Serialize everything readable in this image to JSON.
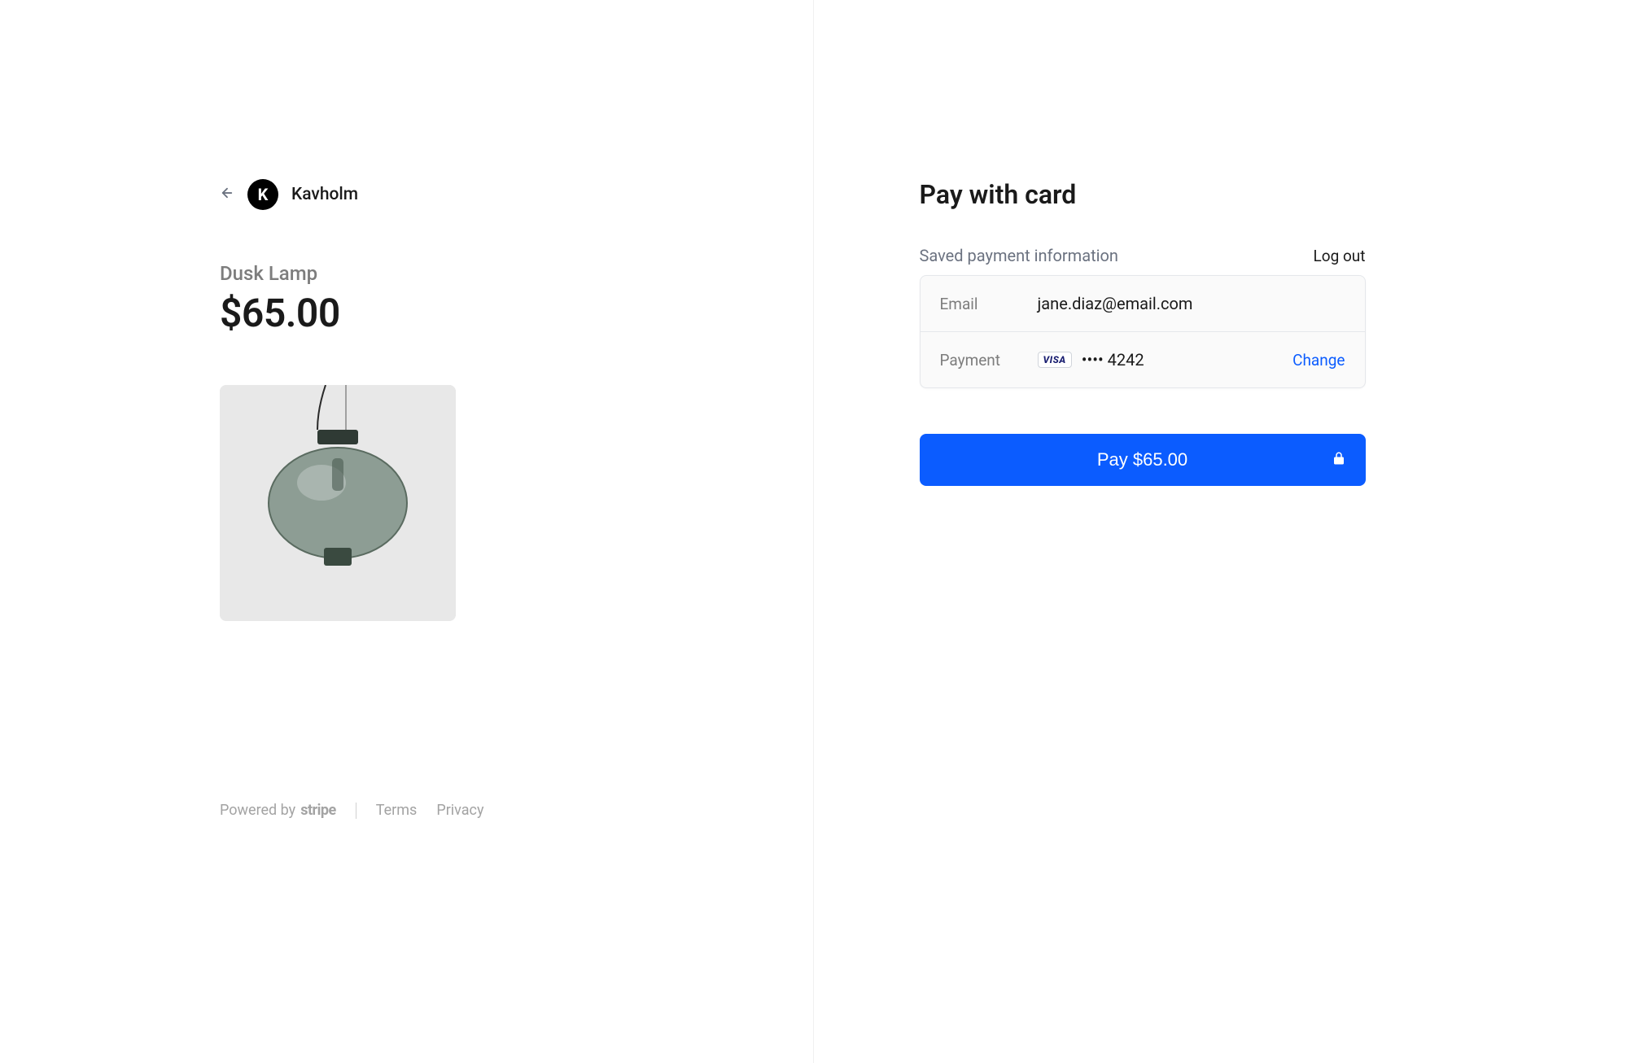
{
  "brand": {
    "name": "Kavholm",
    "logo_letter": "K"
  },
  "product": {
    "name": "Dusk Lamp",
    "price": "$65.00"
  },
  "footer": {
    "powered_by": "Powered by",
    "stripe": "stripe",
    "terms": "Terms",
    "privacy": "Privacy"
  },
  "checkout": {
    "title": "Pay with card",
    "saved_label": "Saved payment information",
    "logout": "Log out",
    "email_label": "Email",
    "email_value": "jane.diaz@email.com",
    "payment_label": "Payment",
    "card_brand": "VISA",
    "card_mask": "•••• 4242",
    "change": "Change",
    "pay_button": "Pay $65.00"
  }
}
